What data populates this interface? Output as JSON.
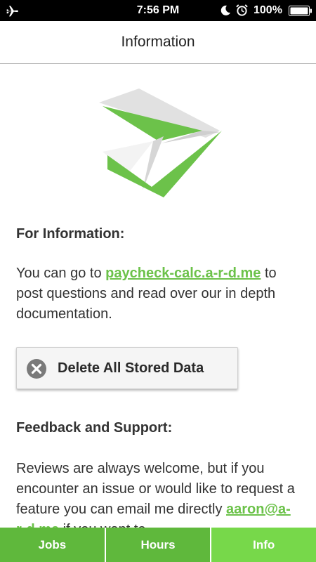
{
  "status_bar": {
    "time": "7:56 PM",
    "battery": "100%"
  },
  "nav": {
    "title": "Information"
  },
  "info_section": {
    "heading": "For Information:",
    "text_before": "You can go to ",
    "link": "paycheck-calc.a-r-d.me",
    "text_after": " to post questions and read over our in depth documentation."
  },
  "delete_button": {
    "label": "Delete All Stored Data",
    "icon": "close-circle-icon"
  },
  "feedback_section": {
    "heading": "Feedback and Support:",
    "text_before": "Reviews are always welcome, but if you encounter an issue or would like to request a feature you can email me directly ",
    "email": "aaron@a-r-d.me",
    "text_after": " if you want to"
  },
  "tabs": [
    {
      "label": "Jobs"
    },
    {
      "label": "Hours"
    },
    {
      "label": "Info",
      "active": true
    }
  ],
  "colors": {
    "accent": "#6cc24a",
    "tab_bg": "#5fb83c",
    "tab_active": "#77d84a",
    "logo_gray": "#dedede"
  }
}
